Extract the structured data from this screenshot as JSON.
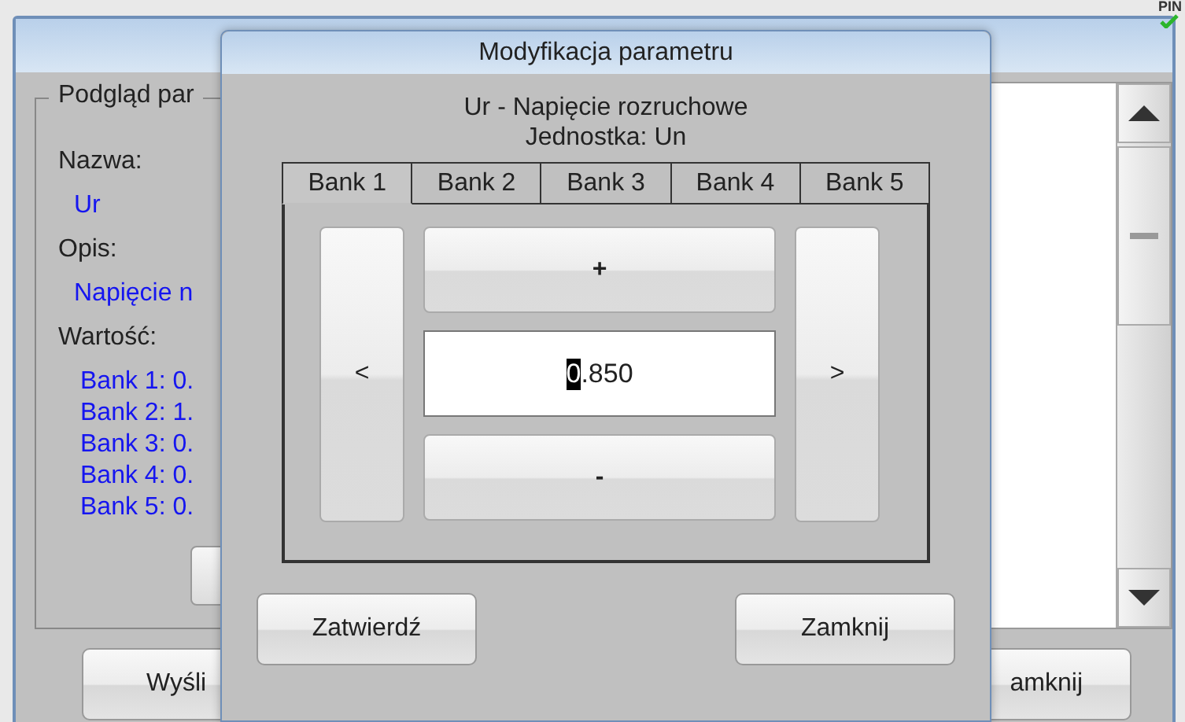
{
  "status_icon": {
    "label": "PIN",
    "ok": true
  },
  "main_window": {
    "group": {
      "title": "Podgląd par",
      "fields": [
        {
          "label": "Nazwa:",
          "value": "Ur"
        },
        {
          "label": "Opis:",
          "value": "Napięcie n"
        }
      ],
      "values_label": "Wartość:",
      "values": [
        "Bank 1: 0.",
        "Bank 2: 1.",
        "Bank 3: 0.",
        "Bank 4: 0.",
        "Bank 5: 0."
      ]
    },
    "buttons": [
      "Wyśli",
      "amknij"
    ]
  },
  "dialog": {
    "title": "Modyfikacja parametru",
    "heading": "Ur - Napięcie rozruchowe",
    "unit": "Jednostka: Un",
    "tabs": [
      {
        "label": "Bank 1",
        "selected": true
      },
      {
        "label": "Bank 2",
        "selected": false
      },
      {
        "label": "Bank 3",
        "selected": false
      },
      {
        "label": "Bank 4",
        "selected": false
      },
      {
        "label": "Bank 5",
        "selected": false
      }
    ],
    "prev": "<",
    "next": ">",
    "increment": "+",
    "decrement": "-",
    "value": {
      "selected_part": "0",
      "rest": ".850"
    },
    "buttons": [
      "Zatwierdź",
      "Zamknij"
    ]
  }
}
